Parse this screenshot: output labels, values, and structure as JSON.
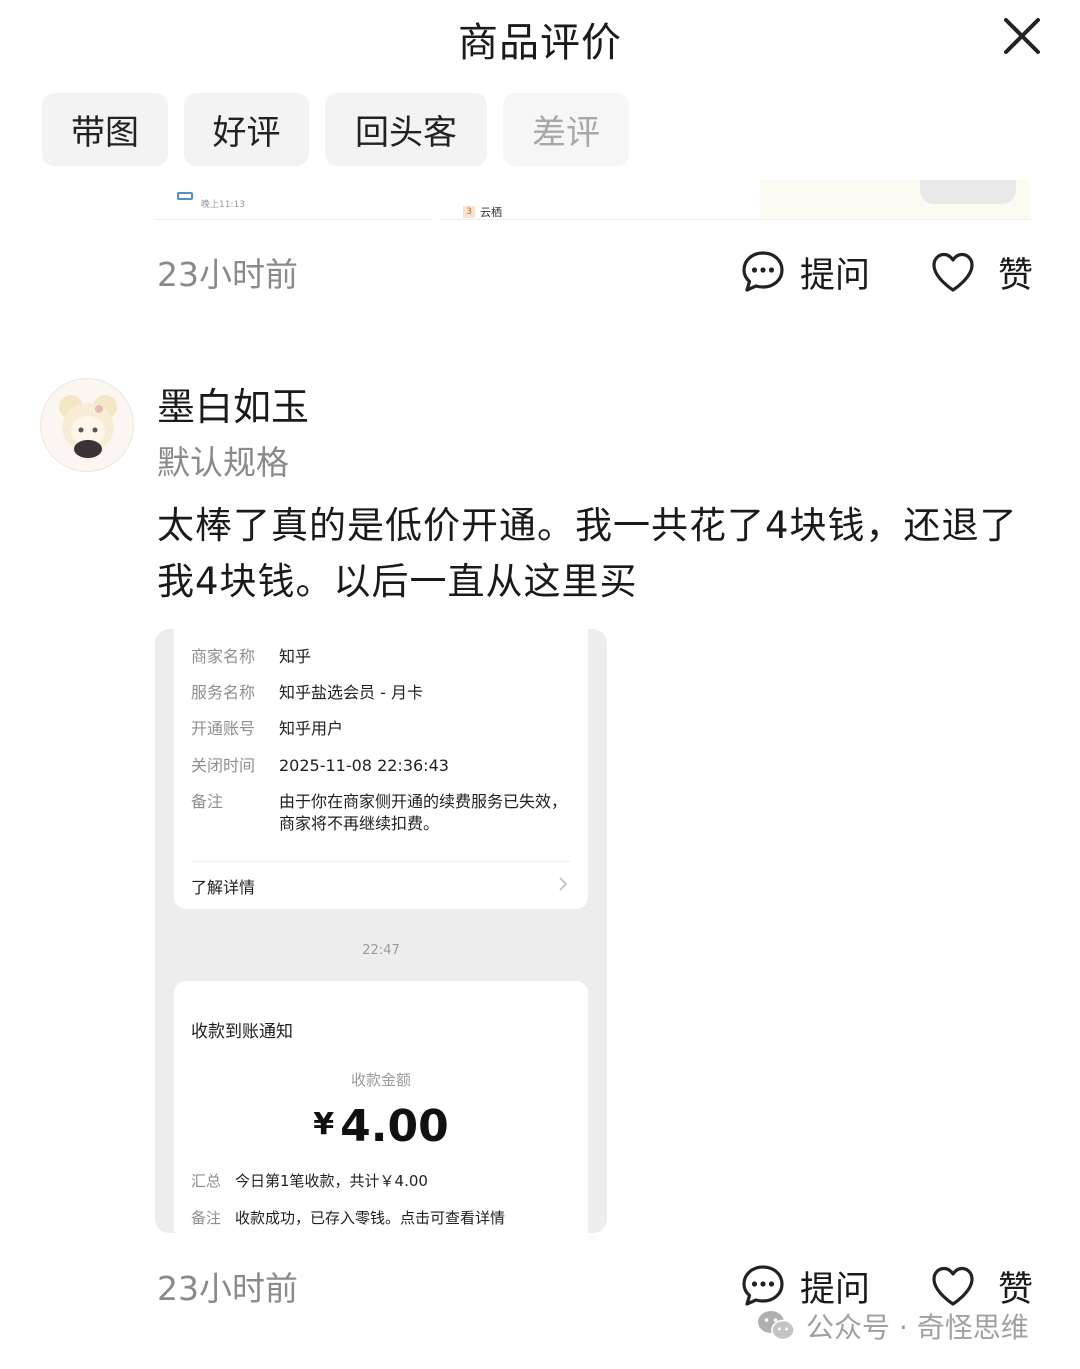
{
  "header": {
    "title": "商品评价"
  },
  "filters": [
    {
      "label": "带图",
      "enabled": true
    },
    {
      "label": "好评",
      "enabled": true
    },
    {
      "label": "回头客",
      "enabled": true
    },
    {
      "label": "差评",
      "enabled": false
    }
  ],
  "previous_review": {
    "strip_text_1": "晚上11:13",
    "strip_badge": "3",
    "strip_text_2": "云栖",
    "time": "23小时前",
    "ask_label": "提问",
    "like_label": "赞"
  },
  "review": {
    "username": "墨白如玉",
    "spec": "默认规格",
    "text": "太棒了真的是低价开通。我一共花了4块钱，还退了我4块钱。以后一直从这里买",
    "screenshot": {
      "card1": {
        "rows": [
          {
            "key": "商家名称",
            "value": "知乎"
          },
          {
            "key": "服务名称",
            "value": "知乎盐选会员 - 月卡"
          },
          {
            "key": "开通账号",
            "value": "知乎用户"
          },
          {
            "key": "关闭时间",
            "value": "2025-11-08 22:36:43"
          },
          {
            "key": "备注",
            "value": "由于你在商家侧开通的续费服务已失效，商家将不再继续扣费。"
          }
        ],
        "more_label": "了解详情"
      },
      "timestamp": "22:47",
      "card2": {
        "title": "收款到账通知",
        "amount_label": "收款金额",
        "currency": "¥",
        "amount": "4.00",
        "rows": [
          {
            "key": "汇总",
            "value": "今日第1笔收款，共计￥4.00"
          },
          {
            "key": "备注",
            "value": "收款成功，已存入零钱。点击可查看详情"
          }
        ]
      }
    },
    "time": "23小时前",
    "ask_label": "提问",
    "like_label": "赞"
  },
  "watermark": {
    "text": "公众号 · 奇怪思维"
  }
}
